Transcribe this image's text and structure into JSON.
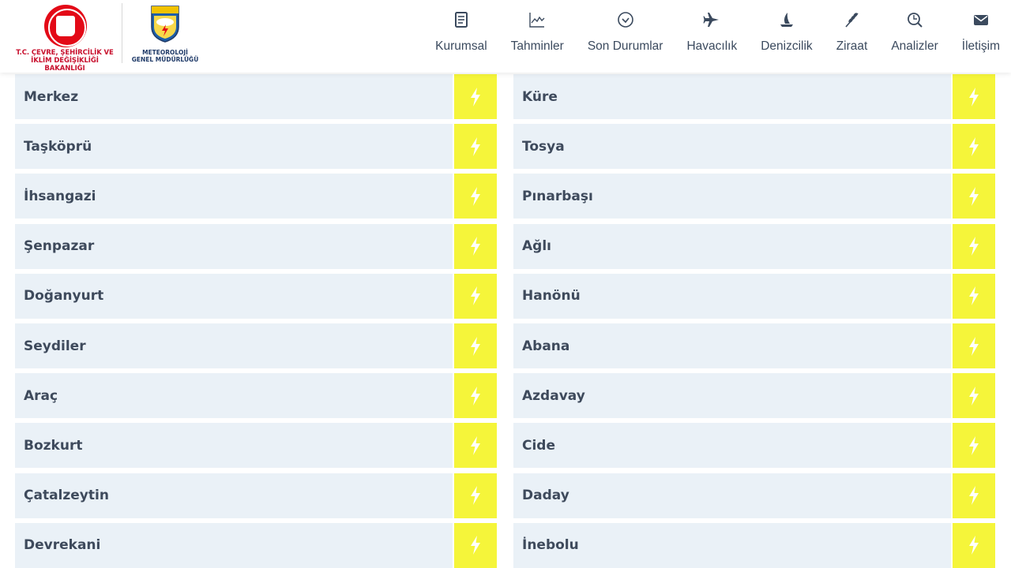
{
  "header": {
    "ministry_logo_text": "T.C. ÇEVRE, ŞEHİRCİLİK VE İKLİM DEĞİŞİKLİĞİ BAKANLIĞI",
    "met_logo_text": "METEOROLOJİ GENEL MÜDÜRLÜĞÜ"
  },
  "nav": {
    "items": [
      {
        "label": "Kurumsal",
        "icon": "document-icon"
      },
      {
        "label": "Tahminler",
        "icon": "chart-icon"
      },
      {
        "label": "Son Durumlar",
        "icon": "check-circle-icon"
      },
      {
        "label": "Havacılık",
        "icon": "airplane-icon"
      },
      {
        "label": "Denizcilik",
        "icon": "sailboat-icon"
      },
      {
        "label": "Ziraat",
        "icon": "wheat-icon"
      },
      {
        "label": "Analizler",
        "icon": "analysis-icon"
      },
      {
        "label": "İletişim",
        "icon": "envelope-icon"
      }
    ]
  },
  "districts": {
    "left": [
      "Merkez",
      "Taşköprü",
      "İhsangazi",
      "Şenpazar",
      "Doğanyurt",
      "Seydiler",
      "Araç",
      "Bozkurt",
      "Çatalzeytin",
      "Devrekani"
    ],
    "right": [
      "Küre",
      "Tosya",
      "Pınarbaşı",
      "Ağlı",
      "Hanönü",
      "Abana",
      "Azdavay",
      "Cide",
      "Daday",
      "İnebolu"
    ]
  },
  "colors": {
    "row_bg": "#eaf1f7",
    "warning_button": "#f5f53a",
    "text": "#3e4a5c",
    "ministry_red": "#c8102e"
  }
}
